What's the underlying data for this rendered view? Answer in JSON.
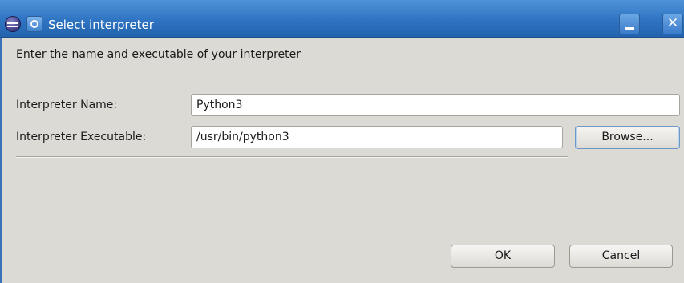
{
  "window": {
    "title": "Select interpreter",
    "eclipse_icon": "eclipse-logo-icon",
    "menu_icon": "window-menu-icon",
    "minimize_icon": "minimize-icon",
    "close_icon": "close-icon",
    "close_glyph": "✕"
  },
  "dialog": {
    "description": "Enter the name and executable of your interpreter"
  },
  "form": {
    "name_label": "Interpreter Name:",
    "name_value": "Python3",
    "executable_label": "Interpreter Executable:",
    "executable_value": "/usr/bin/python3",
    "browse_label": "Browse..."
  },
  "buttons": {
    "ok_label": "OK",
    "cancel_label": "Cancel"
  },
  "colors": {
    "titlebar": "#2f74c2",
    "dialog_background": "#dcdad5"
  }
}
